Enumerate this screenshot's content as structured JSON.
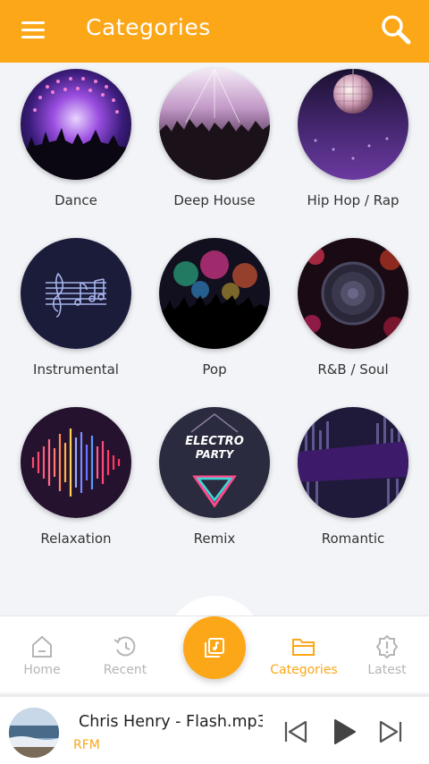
{
  "header": {
    "title": "Categories",
    "menu_icon": "menu-icon",
    "search_icon": "search-icon",
    "accent": "#fba718"
  },
  "categories": [
    {
      "label": "Dance"
    },
    {
      "label": "Deep House"
    },
    {
      "label": "Hip Hop / Rap"
    },
    {
      "label": "Instrumental"
    },
    {
      "label": "Pop"
    },
    {
      "label": "R&B / Soul"
    },
    {
      "label": "Relaxation"
    },
    {
      "label": "Remix"
    },
    {
      "label": "Romantic"
    }
  ],
  "remix_art": {
    "line1": "ELECTRO",
    "line2": "PARTY"
  },
  "nav": {
    "items": [
      {
        "label": "Home",
        "icon": "home-icon"
      },
      {
        "label": "Recent",
        "icon": "history-icon"
      },
      {
        "label": "Categories",
        "icon": "folder-icon",
        "active": true
      },
      {
        "label": "Latest",
        "icon": "alert-badge-icon"
      }
    ],
    "center_icon": "library-icon"
  },
  "player": {
    "title": "Chris Henry - Flash.mp3",
    "subtitle": "RFM",
    "controls": [
      "previous-icon",
      "play-icon",
      "next-icon"
    ]
  }
}
